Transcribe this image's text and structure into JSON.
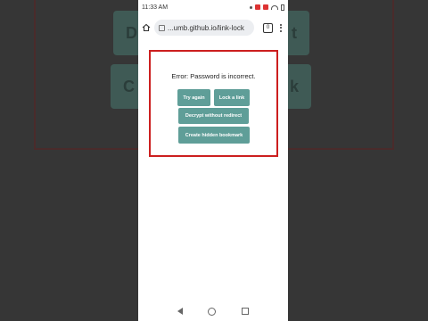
{
  "status_bar": {
    "time": "11:33 AM"
  },
  "browser": {
    "url": "...umb.github.io/link-lock",
    "tab_count": "0"
  },
  "dialog": {
    "error_text": "Error: Password is incorrect.",
    "buttons": {
      "try_again": "Try again",
      "lock_link": "Lock a link",
      "decrypt": "Decrypt without redirect",
      "bookmark": "Create hidden bookmark"
    }
  },
  "background": {
    "ghost_labels": [
      "D",
      "t",
      "C",
      "k"
    ]
  },
  "colors": {
    "button": "#5f9e98",
    "frame": "#cc1f1f"
  }
}
